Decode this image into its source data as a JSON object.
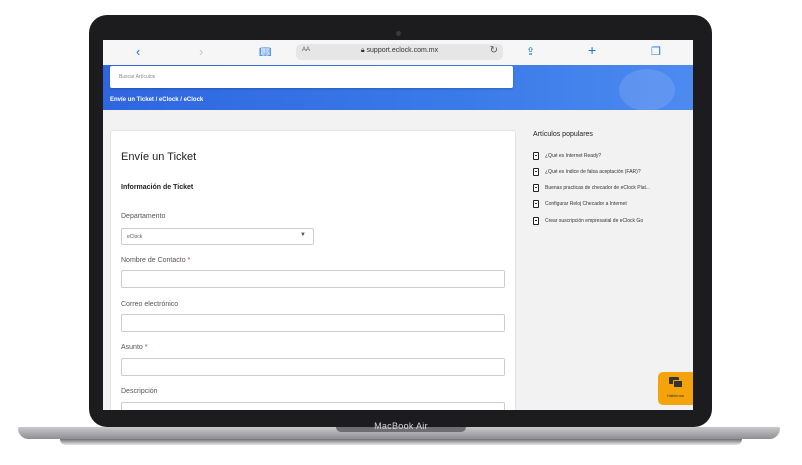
{
  "device": {
    "label": "MacBook Air"
  },
  "browser": {
    "text_size_label": "AA",
    "url": "support.eclock.com.mx",
    "icons": [
      "back-icon",
      "forward-icon",
      "bookmarks-icon",
      "lock-icon",
      "reload-icon",
      "share-icon",
      "new-tab-icon",
      "tabs-icon"
    ]
  },
  "hero": {
    "search_placeholder": "Buscar Artículos",
    "breadcrumb": "Envíe un Ticket  /  eClock  /  eClock"
  },
  "form": {
    "title": "Envíe un Ticket",
    "section": "Información de Ticket",
    "department_label": "Departamento",
    "department_value": "eClock",
    "contact_label": "Nombre de Contacto",
    "contact_required": "*",
    "email_label": "Correo electrónico",
    "subject_label": "Asunto",
    "subject_required": "*",
    "description_label": "Descripción"
  },
  "sidebar": {
    "title": "Artículos populares",
    "items": [
      {
        "label": "¿Qué es Internet Ready?"
      },
      {
        "label": "¿Qué es índice de falsa aceptación (FAR)?"
      },
      {
        "label": "Buenas practicas de checador de eClock Plat..."
      },
      {
        "label": "Configurar Reloj Checador a Internet"
      },
      {
        "label": "Crear suscripción empresarial de eClock Go"
      }
    ]
  },
  "chat": {
    "label": "Háblenos"
  },
  "colors": {
    "accent": "#3a7ae8",
    "chat": "#f5a30a",
    "link_blue": "#1a73e8"
  }
}
